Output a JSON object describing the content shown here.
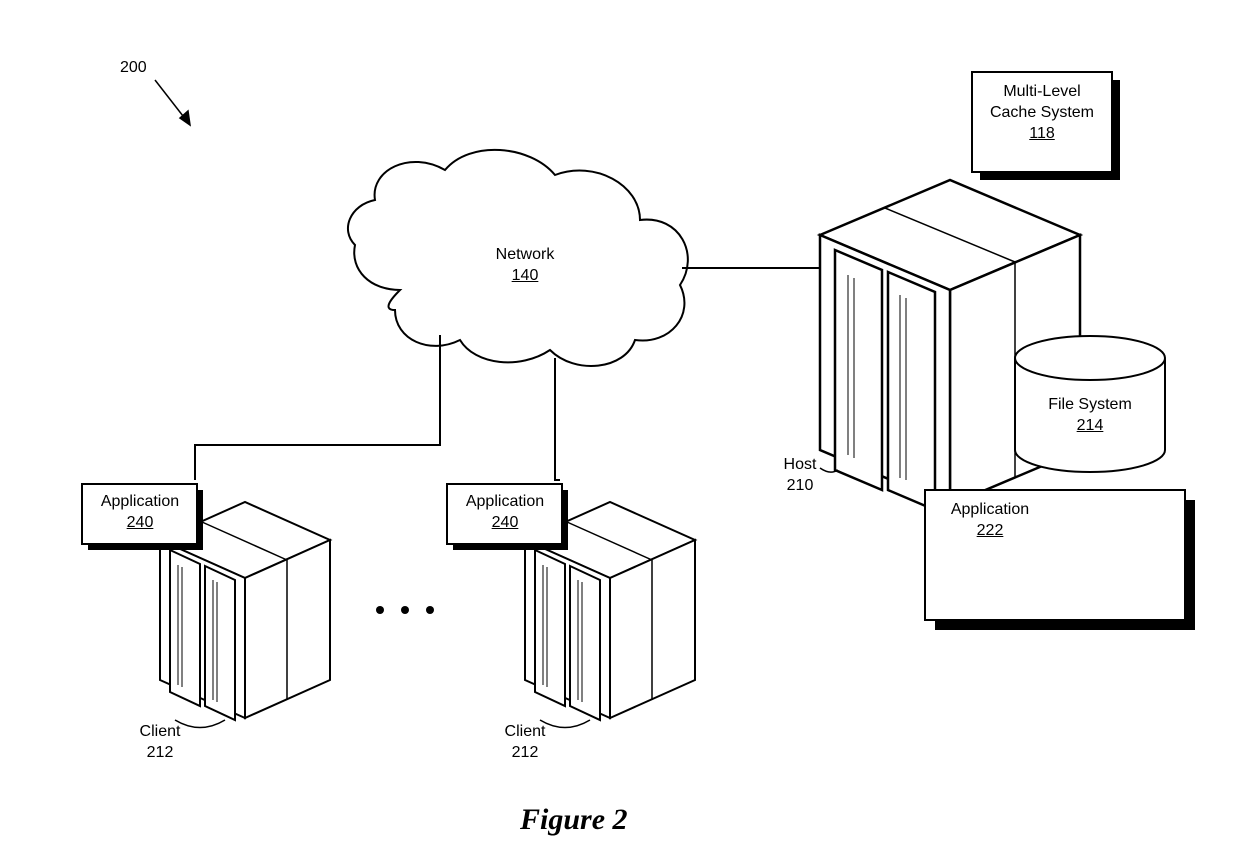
{
  "figure": {
    "number_label": "200",
    "title": "Figure 2"
  },
  "network": {
    "label": "Network",
    "number": "140"
  },
  "host": {
    "label": "Host",
    "number": "210"
  },
  "cache": {
    "line1": "Multi-Level",
    "line2": "Cache System",
    "number": "118"
  },
  "filesystem": {
    "label": "File System",
    "number": "214"
  },
  "host_app": {
    "label": "Application",
    "number": "222"
  },
  "client1": {
    "app_label": "Application",
    "app_number": "240",
    "client_label": "Client",
    "client_number": "212"
  },
  "client2": {
    "app_label": "Application",
    "app_number": "240",
    "client_label": "Client",
    "client_number": "212"
  },
  "ellipsis": "● ● ●"
}
